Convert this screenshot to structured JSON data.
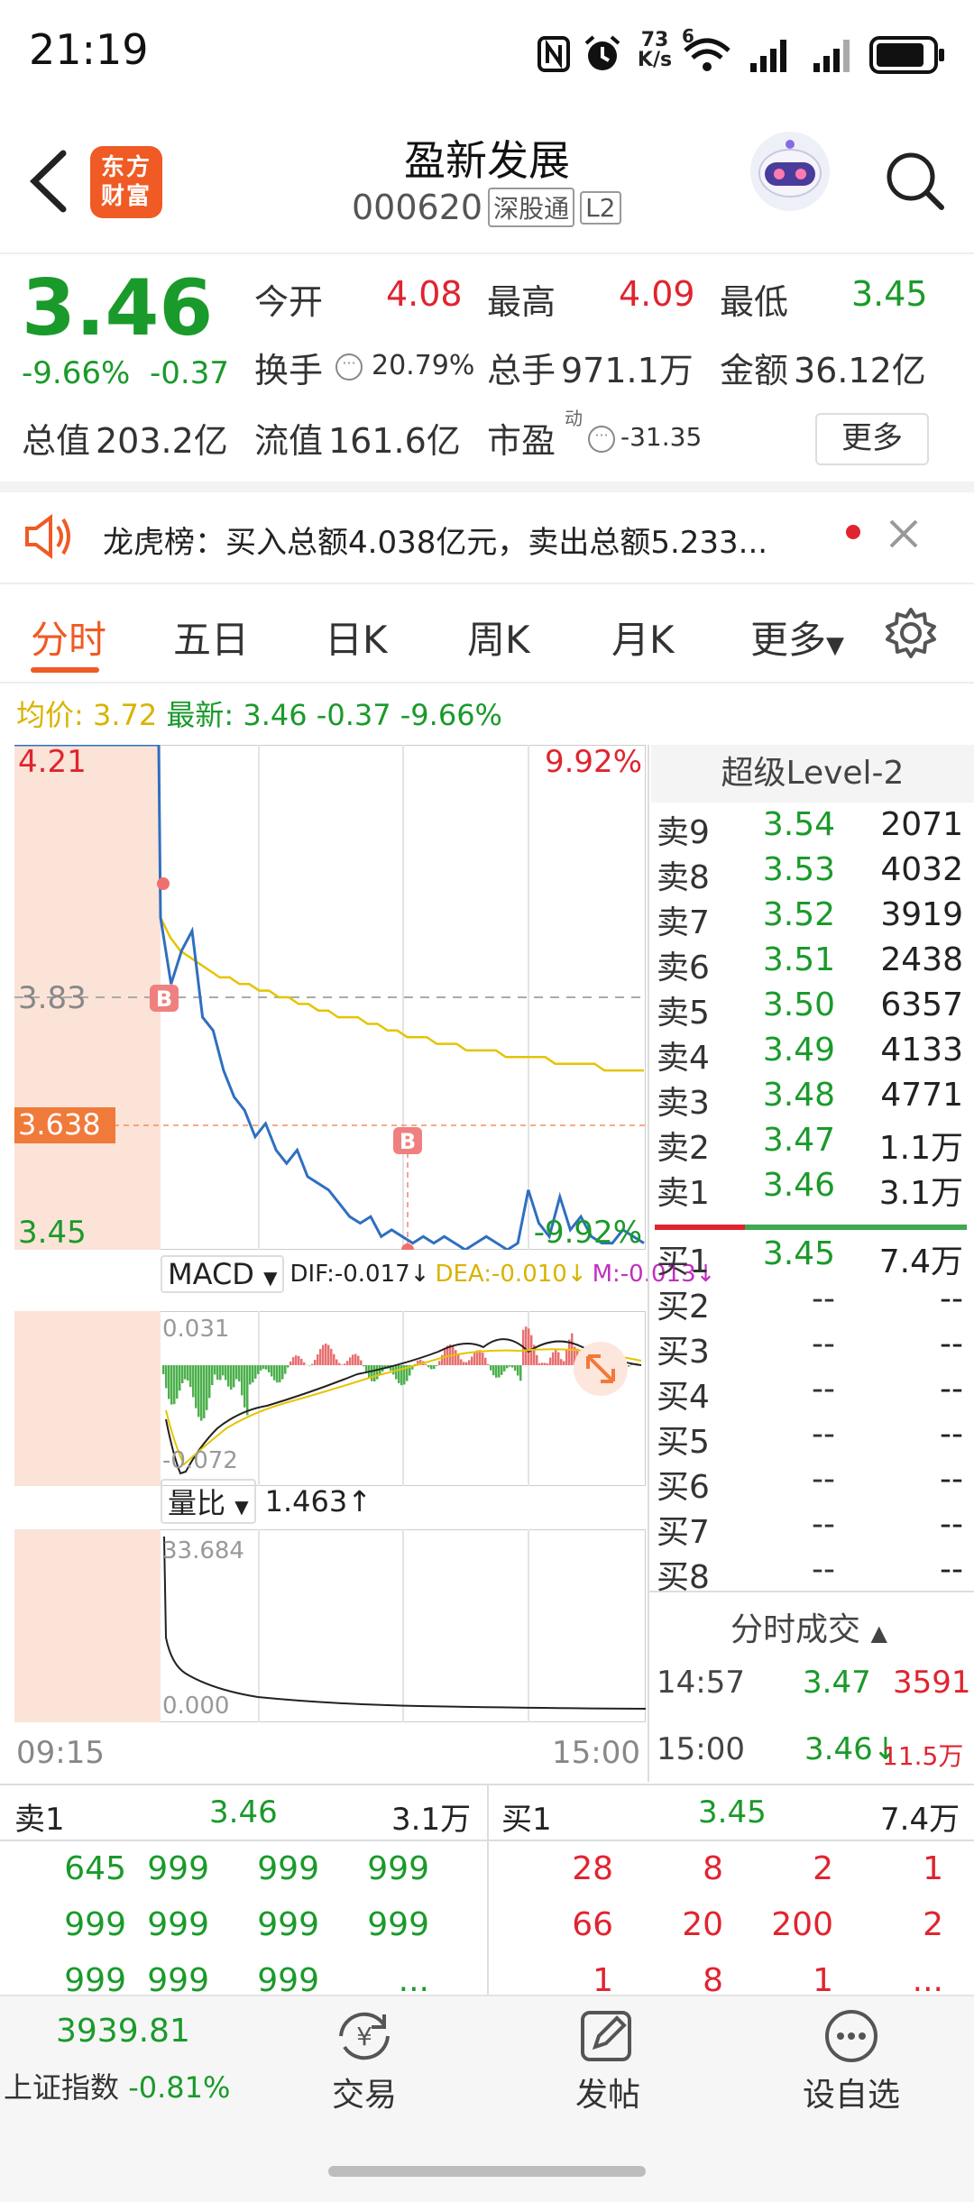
{
  "status_bar": {
    "time": "21:19",
    "net_speed_top": "73",
    "net_speed_bottom": "K/s",
    "wifi_sup": "6"
  },
  "header": {
    "stock_name": "盈新发展",
    "stock_code": "000620",
    "tag1": "深股通",
    "tag2": "L2",
    "logo_text": "东方财富"
  },
  "quote": {
    "price": "3.46",
    "change_pct": "-9.66%",
    "change": "-0.37",
    "open_label": "今开",
    "open": "4.08",
    "high_label": "最高",
    "high": "4.09",
    "low_label": "最低",
    "low": "3.45",
    "turnover_label": "换手",
    "turnover": "20.79%",
    "volume_label": "总手",
    "volume": "971.1万",
    "amount_label": "金额",
    "amount": "36.12亿",
    "mktcap_label": "总值",
    "mktcap": "203.2亿",
    "float_label": "流值",
    "float": "161.6亿",
    "pe_label": "市盈",
    "pe_sup": "动",
    "pe": "-31.35",
    "more_label": "更多"
  },
  "notice": {
    "text": "龙虎榜：买入总额4.038亿元，卖出总额5.233..."
  },
  "tabs": {
    "items": [
      "分时",
      "五日",
      "日K",
      "周K",
      "月K"
    ],
    "more": "更多"
  },
  "chart_info": {
    "avg_label": "均价:",
    "avg_value": "3.72",
    "latest_label": "最新:",
    "latest_value": "3.46 -0.37 -9.66%"
  },
  "chart_data": {
    "type": "line",
    "ylim": [
      3.45,
      4.21
    ],
    "y_tick_labels": {
      "top": "4.21",
      "mid": "3.83",
      "bottom": "3.45",
      "top_pct": "9.92%",
      "bottom_pct": "-9.92%",
      "hover": "3.638"
    },
    "x_tick_labels": {
      "start": "09:15",
      "end": "15:00"
    },
    "series": [
      {
        "values": [
          4.21,
          4.21,
          4.21,
          3.95,
          3.85,
          3.9,
          3.93,
          3.8,
          3.78,
          3.72,
          3.68,
          3.66,
          3.62,
          3.64,
          3.6,
          3.58,
          3.6,
          3.56,
          3.55,
          3.54,
          3.52,
          3.5,
          3.49,
          3.5,
          3.47,
          3.48,
          3.47,
          3.46,
          3.47,
          3.46,
          3.47,
          3.46,
          3.45,
          3.46,
          3.47,
          3.46,
          3.45,
          3.46,
          3.54,
          3.49,
          3.47,
          3.53,
          3.48,
          3.5,
          3.47,
          3.46,
          3.46,
          3.48,
          3.47,
          3.46
        ]
      },
      {
        "values": [
          3.95,
          3.92,
          3.9,
          3.89,
          3.88,
          3.87,
          3.86,
          3.86,
          3.85,
          3.85,
          3.84,
          3.84,
          3.83,
          3.83,
          3.82,
          3.82,
          3.81,
          3.81,
          3.8,
          3.8,
          3.8,
          3.79,
          3.79,
          3.78,
          3.78,
          3.77,
          3.77,
          3.77,
          3.76,
          3.76,
          3.76,
          3.75,
          3.75,
          3.75,
          3.75,
          3.74,
          3.74,
          3.74,
          3.74,
          3.74,
          3.73,
          3.73,
          3.73,
          3.73,
          3.73,
          3.72,
          3.72,
          3.72,
          3.72,
          3.72
        ]
      }
    ],
    "markers": [
      "B",
      "B"
    ]
  },
  "macd": {
    "label": "MACD",
    "dif": "DIF:-0.017↓",
    "dea": "DEA:-0.010↓",
    "m": "M:-0.013↓",
    "top": "0.031",
    "bottom": "-0.072"
  },
  "volume_ratio": {
    "label": "量比",
    "value": "1.463↑",
    "top": "33.684",
    "bottom": "0.000"
  },
  "order_book": {
    "title": "超级Level-2",
    "asks": [
      {
        "label": "卖9",
        "price": "3.54",
        "vol": "2071"
      },
      {
        "label": "卖8",
        "price": "3.53",
        "vol": "4032"
      },
      {
        "label": "卖7",
        "price": "3.52",
        "vol": "3919"
      },
      {
        "label": "卖6",
        "price": "3.51",
        "vol": "2438"
      },
      {
        "label": "卖5",
        "price": "3.50",
        "vol": "6357"
      },
      {
        "label": "卖4",
        "price": "3.49",
        "vol": "4133"
      },
      {
        "label": "卖3",
        "price": "3.48",
        "vol": "4771"
      },
      {
        "label": "卖2",
        "price": "3.47",
        "vol": "1.1万"
      },
      {
        "label": "卖1",
        "price": "3.46",
        "vol": "3.1万"
      }
    ],
    "bids": [
      {
        "label": "买1",
        "price": "3.45",
        "vol": "7.4万"
      },
      {
        "label": "买2",
        "price": "--",
        "vol": "--"
      },
      {
        "label": "买3",
        "price": "--",
        "vol": "--"
      },
      {
        "label": "买4",
        "price": "--",
        "vol": "--"
      },
      {
        "label": "买5",
        "price": "--",
        "vol": "--"
      },
      {
        "label": "买6",
        "price": "--",
        "vol": "--"
      },
      {
        "label": "买7",
        "price": "--",
        "vol": "--"
      },
      {
        "label": "买8",
        "price": "--",
        "vol": "--"
      }
    ],
    "trades_title": "分时成交",
    "trades": [
      {
        "time": "14:57",
        "price": "3.47",
        "vol": "3591"
      },
      {
        "time": "15:00",
        "price": "3.46↓",
        "vol": "11.5万"
      }
    ]
  },
  "queue": {
    "sell_label": "卖1",
    "sell_price": "3.46",
    "sell_vol": "3.1万",
    "buy_label": "买1",
    "buy_price": "3.45",
    "buy_vol": "7.4万",
    "sell_rows": [
      [
        "645",
        "999",
        "999",
        "999"
      ],
      [
        "999",
        "999",
        "999",
        "999"
      ],
      [
        "999",
        "999",
        "999",
        "..."
      ]
    ],
    "buy_rows": [
      [
        "28",
        "8",
        "2",
        "1"
      ],
      [
        "66",
        "20",
        "200",
        "2"
      ],
      [
        "1",
        "8",
        "1",
        "..."
      ]
    ]
  },
  "bottom_nav": {
    "index_value": "3939.81",
    "index_name": "上证指数",
    "index_change": "-0.81%",
    "trade": "交易",
    "post": "发帖",
    "watch": "设自选"
  }
}
